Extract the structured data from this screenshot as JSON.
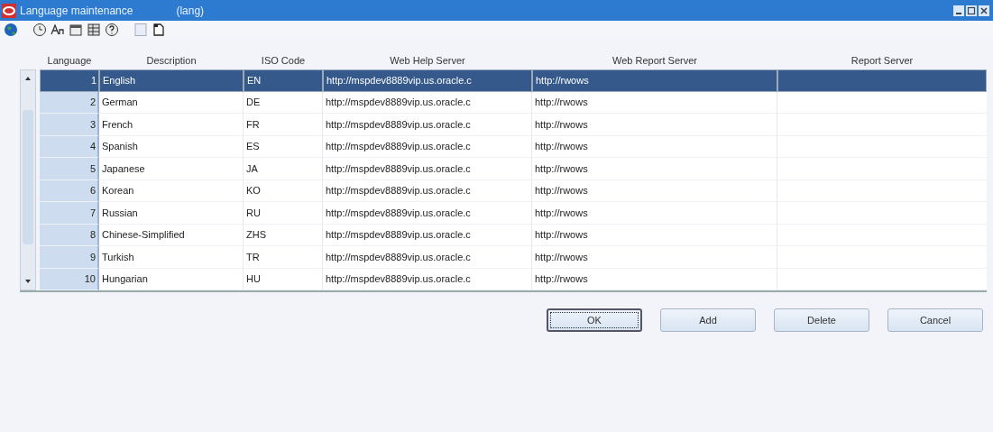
{
  "window": {
    "title": "Language maintenance",
    "subtitle": "(lang)"
  },
  "table": {
    "columns": [
      "Language",
      "Description",
      "ISO Code",
      "Web Help Server",
      "Web Report Server",
      "Report Server"
    ],
    "rows": [
      {
        "language": "1",
        "description": "English",
        "iso_code": "EN",
        "web_help_server": "http://mspdev8889vip.us.oracle.c",
        "web_report_server": "http://rwows",
        "selected": true
      },
      {
        "language": "2",
        "description": "German",
        "iso_code": "DE",
        "web_help_server": "http://mspdev8889vip.us.oracle.c",
        "web_report_server": "http://rwows",
        "selected": false
      },
      {
        "language": "3",
        "description": "French",
        "iso_code": "FR",
        "web_help_server": "http://mspdev8889vip.us.oracle.c",
        "web_report_server": "http://rwows",
        "selected": false
      },
      {
        "language": "4",
        "description": "Spanish",
        "iso_code": "ES",
        "web_help_server": "http://mspdev8889vip.us.oracle.c",
        "web_report_server": "http://rwows",
        "selected": false
      },
      {
        "language": "5",
        "description": "Japanese",
        "iso_code": "JA",
        "web_help_server": "http://mspdev8889vip.us.oracle.c",
        "web_report_server": "http://rwows",
        "selected": false
      },
      {
        "language": "6",
        "description": "Korean",
        "iso_code": "KO",
        "web_help_server": "http://mspdev8889vip.us.oracle.c",
        "web_report_server": "http://rwows",
        "selected": false
      },
      {
        "language": "7",
        "description": "Russian",
        "iso_code": "RU",
        "web_help_server": "http://mspdev8889vip.us.oracle.c",
        "web_report_server": "http://rwows",
        "selected": false
      },
      {
        "language": "8",
        "description": "Chinese-Simplified",
        "iso_code": "ZHS",
        "web_help_server": "http://mspdev8889vip.us.oracle.c",
        "web_report_server": "http://rwows",
        "selected": false
      },
      {
        "language": "9",
        "description": "Turkish",
        "iso_code": "TR",
        "web_help_server": "http://mspdev8889vip.us.oracle.c",
        "web_report_server": "http://rwows",
        "selected": false
      },
      {
        "language": "10",
        "description": "Hungarian",
        "iso_code": "HU",
        "web_help_server": "http://mspdev8889vip.us.oracle.c",
        "web_report_server": "http://rwows",
        "selected": false
      }
    ]
  },
  "buttons": [
    {
      "label": "OK",
      "focused": true
    },
    {
      "label": "Add",
      "focused": false
    },
    {
      "label": "Delete",
      "focused": false
    },
    {
      "label": "Cancel",
      "focused": false
    }
  ]
}
